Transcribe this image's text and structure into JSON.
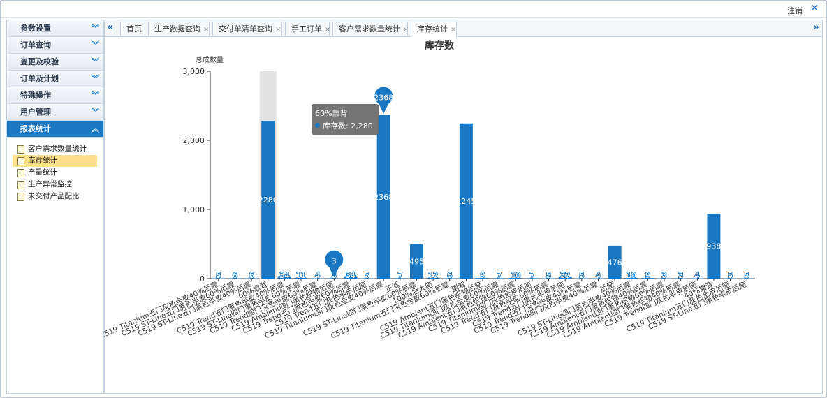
{
  "topbar": {
    "logout_label": "注销",
    "close_symbol": "✕"
  },
  "sidebar": {
    "sections": [
      {
        "label": "参数设置",
        "active": false
      },
      {
        "label": "订单查询",
        "active": false
      },
      {
        "label": "变更及校验",
        "active": false
      },
      {
        "label": "订单及计划",
        "active": false
      },
      {
        "label": "特殊操作",
        "active": false
      },
      {
        "label": "用户管理",
        "active": false
      },
      {
        "label": "报表统计",
        "active": true
      }
    ],
    "report_items": [
      "客户需求数量统计",
      "库存统计",
      "产量统计",
      "生产异常监控",
      "未交付产品配比"
    ],
    "selected_item": "库存统计"
  },
  "tabs": [
    {
      "label": "首页",
      "closable": false
    },
    {
      "label": "生产数据查询",
      "closable": true
    },
    {
      "label": "交付单清单查询",
      "closable": true
    },
    {
      "label": "手工订单",
      "closable": true
    },
    {
      "label": "客户需求数量统计",
      "closable": true
    },
    {
      "label": "库存统计",
      "closable": true,
      "active": true
    }
  ],
  "tooltip": {
    "title": "60%靠背",
    "series_label": "库存数: 2,280"
  },
  "colors": {
    "bar": "#1a78c2",
    "accent": "#1a78c2",
    "highlight": "#e2e2e2"
  },
  "chart_data": {
    "type": "bar",
    "title": "库存数",
    "ylabel": "总成数量",
    "ylim": [
      0,
      3000
    ],
    "yticks": [
      "0",
      "1,000",
      "2,000",
      "3,000"
    ],
    "categories": [
      "C519 Titanium五门灰色全皮40%后靠",
      "C519 ST-Line五门黑色半皮60%后靠",
      "C519 ST-Line五门黑色半皮40%后靠",
      "60%靠背",
      "C519 Trend五门黑色半皮40%后靠",
      "C519 ST-Line四门黑色半皮60%后靠",
      "C519 Trend四门灰色半皮60%后靠",
      "C519 Ambient四门黑色织物后座",
      "C519 Trend五门黑色半皮60%后靠",
      "C519 Trend五门灰色半皮后座",
      "C519 Titanium四门灰色全皮40%后靠",
      "正驾",
      "C519 ST-Line四门黑色半皮60%后靠",
      "100%后大座",
      "C519 Titanium五门灰色全皮60%后靠",
      "副驾",
      "C519 Ambient五门黑色织物后座",
      "C519 Titanium四门灰色全皮60%后靠",
      "C519 Ambient五门黑色织物60%后靠",
      "C519 Titanium四门灰色全皮后座",
      "C519 Trend五门灰色半皮60%后靠",
      "C519 Trend五门黑色半皮后座",
      "C519 Trend五门灰色半皮40%后靠",
      "C519 Trend四门灰色半皮40%后靠",
      "后座",
      "C519 ST-Line四门黑色半皮40%后靠",
      "C519 Ambient五门黑色织物40%后靠",
      "C519 Ambient四门黑色织物60%后靠",
      "C519 Ambient四门黑色织物40%后靠",
      "C519 Trend四门灰色半皮后座",
      "40%靠背",
      "C519 Titanium五门灰色全皮后座",
      "C519 ST-Line五门黑色半皮后座"
    ],
    "values": [
      5,
      6,
      6,
      2280,
      34,
      11,
      4,
      3,
      34,
      5,
      2368,
      7,
      495,
      12,
      6,
      2245,
      9,
      7,
      10,
      7,
      5,
      32,
      5,
      4,
      476,
      10,
      9,
      3,
      3,
      4,
      938,
      5,
      5
    ],
    "show_label_in_bar": [
      false,
      false,
      false,
      true,
      false,
      false,
      false,
      false,
      false,
      false,
      true,
      false,
      true,
      false,
      false,
      true,
      false,
      false,
      false,
      false,
      false,
      false,
      false,
      false,
      true,
      false,
      false,
      false,
      false,
      false,
      true,
      false,
      false
    ],
    "pins": [
      {
        "label": "3",
        "index": 7
      },
      {
        "label": "2368",
        "index": 10
      }
    ],
    "hover_index": 3,
    "grid": false,
    "legend": "none"
  }
}
